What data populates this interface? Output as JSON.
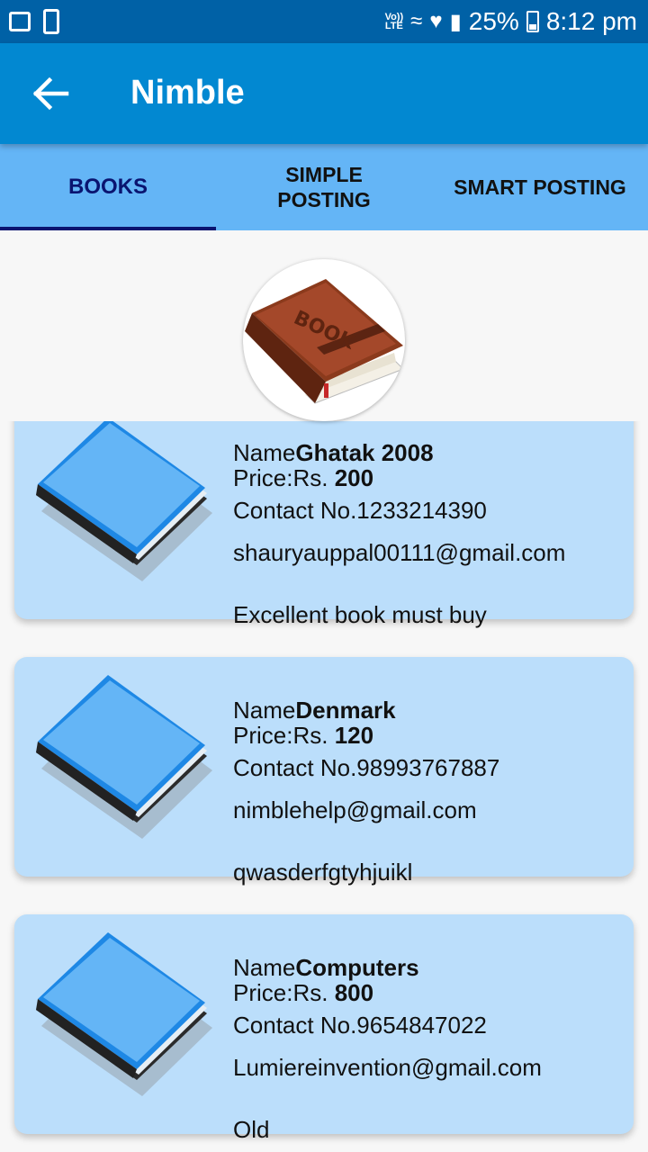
{
  "statusbar": {
    "volte_line1": "Vo))",
    "volte_line2": "LTE",
    "battery_pct": "25%",
    "time": "8:12 pm"
  },
  "appbar": {
    "title": "Nimble"
  },
  "tabs": [
    {
      "label": "BOOKS",
      "active": true
    },
    {
      "label": "SIMPLE POSTING",
      "active": false
    },
    {
      "label": "SMART POSTING",
      "active": false
    }
  ],
  "header": {
    "logo_text": "BOOK"
  },
  "labels": {
    "name": "Name",
    "price": "Price:Rs.",
    "contact": "Contact No."
  },
  "books": [
    {
      "name": "Ghatak 2008",
      "price": "200",
      "contact": "1233214390",
      "email": "shauryauppal00111@gmail.com",
      "description": "Excellent book must buy"
    },
    {
      "name": "Denmark",
      "price": "120",
      "contact": "98993767887",
      "email": "nimblehelp@gmail.com",
      "description": "qwasderfgtyhjuikl"
    },
    {
      "name": "Computers",
      "price": "800",
      "contact": "9654847022",
      "email": "Lumiereinvention@gmail.com",
      "description": "Old"
    }
  ],
  "colors": {
    "statusbar": "#0061a6",
    "appbar": "#0288d1",
    "tabs": "#64b5f6",
    "tab_indicator": "#0a1470",
    "card": "#bbdefb"
  }
}
